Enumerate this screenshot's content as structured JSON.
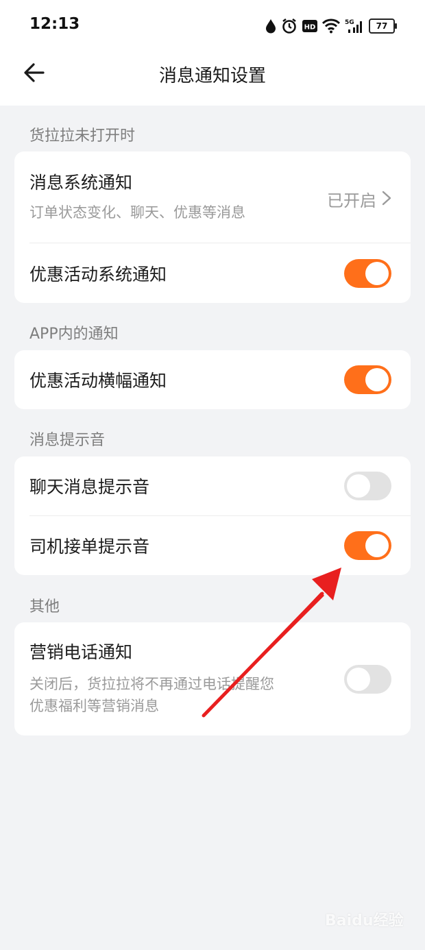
{
  "status_bar": {
    "time": "12:13",
    "hd_label": "HD",
    "network_label": "5G",
    "battery_level": "77",
    "icons": [
      "drop-icon",
      "alarm-icon",
      "hd-icon",
      "wifi-icon",
      "signal-5g-icon",
      "battery-icon"
    ]
  },
  "header": {
    "title": "消息通知设置",
    "back_icon": "arrow-left-icon"
  },
  "sections": [
    {
      "label": "货拉拉未打开时",
      "rows": [
        {
          "title": "消息系统通知",
          "subtitle": "订单状态变化、聊天、优惠等消息",
          "value": "已开启",
          "type": "link"
        },
        {
          "title": "优惠活动系统通知",
          "type": "toggle",
          "on": true
        }
      ]
    },
    {
      "label": "APP内的通知",
      "rows": [
        {
          "title": "优惠活动横幅通知",
          "type": "toggle",
          "on": true
        }
      ]
    },
    {
      "label": "消息提示音",
      "rows": [
        {
          "title": "聊天消息提示音",
          "type": "toggle",
          "on": false
        },
        {
          "title": "司机接单提示音",
          "type": "toggle",
          "on": true
        }
      ]
    },
    {
      "label": "其他",
      "rows": [
        {
          "title": "营销电话通知",
          "subtitle_lines": [
            "关闭后，货拉拉将不再通过电话提醒您",
            "优惠福利等营销消息"
          ],
          "type": "toggle",
          "on": false
        }
      ]
    }
  ],
  "watermark": "Baidu经验",
  "colors": {
    "accent": "#ff6f1a",
    "annotation_arrow": "#e81f1f",
    "background": "#f2f3f5"
  }
}
